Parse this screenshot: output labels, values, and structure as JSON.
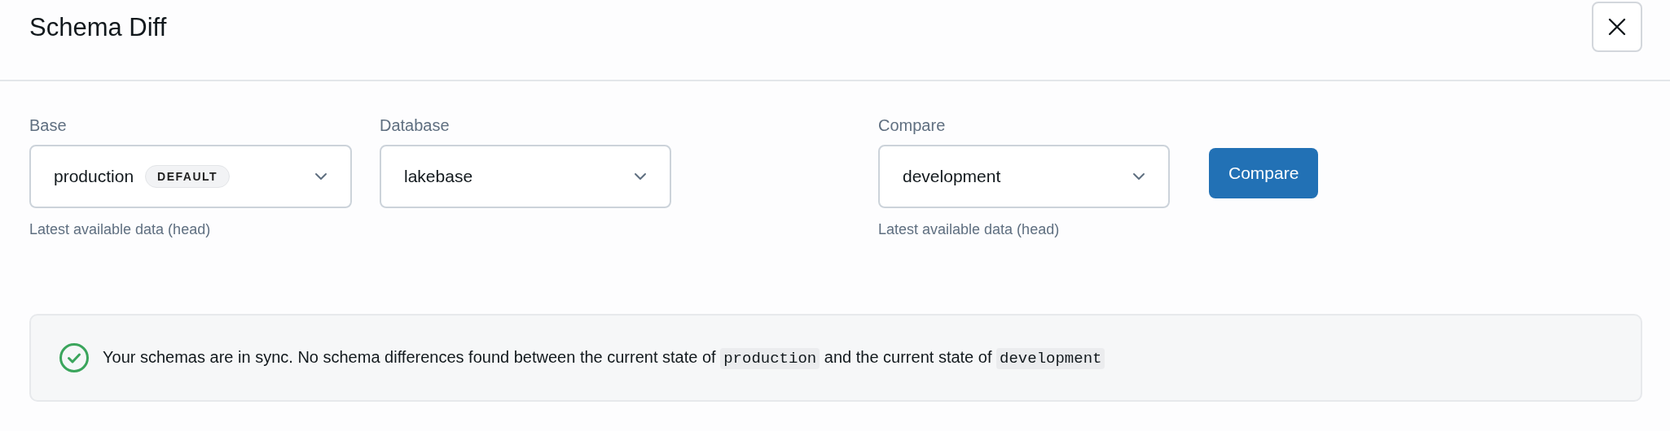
{
  "dialog": {
    "title": "Schema Diff"
  },
  "fields": [
    {
      "label": "Base",
      "value": "production",
      "badge": "DEFAULT",
      "hint": "Latest available data (head)"
    },
    {
      "label": "Database",
      "value": "lakebase"
    },
    {
      "label": "Compare",
      "value": "development",
      "hint": "Latest available data (head)"
    }
  ],
  "compare_button": "Compare",
  "message": {
    "success": true,
    "parts": [
      {
        "kind": "text",
        "text": "Your schemas are in sync. No schema differences found between the current state of "
      },
      {
        "kind": "code",
        "text": "production"
      },
      {
        "kind": "text",
        "text": " and the current state of "
      },
      {
        "kind": "code",
        "text": "development"
      }
    ]
  }
}
